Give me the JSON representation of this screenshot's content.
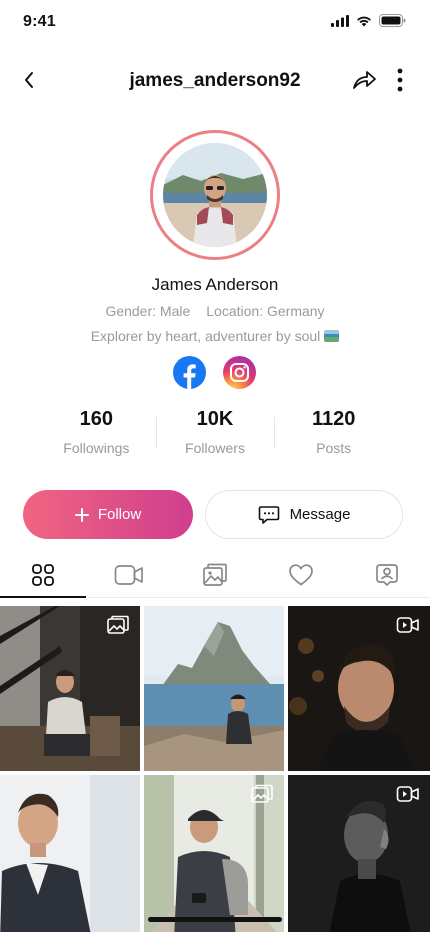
{
  "status_bar": {
    "time": "9:41"
  },
  "header": {
    "username": "james_anderson92"
  },
  "profile": {
    "name": "James Anderson",
    "gender": "Gender: Male",
    "location": "Location: Germany",
    "bio": "Explorer by heart, adventurer by soul"
  },
  "socials": [
    {
      "name": "Facebook",
      "icon": "facebook-icon"
    },
    {
      "name": "Instagram",
      "icon": "instagram-icon"
    }
  ],
  "stats": [
    {
      "value": "160",
      "label": "Followings"
    },
    {
      "value": "10K",
      "label": "Followers"
    },
    {
      "value": "1120",
      "label": "Posts"
    }
  ],
  "actions": {
    "follow_label": "Follow",
    "message_label": "Message"
  },
  "tabs": [
    {
      "icon": "grid-icon",
      "active": true
    },
    {
      "icon": "video-icon",
      "active": false
    },
    {
      "icon": "gallery-icon",
      "active": false
    },
    {
      "icon": "heart-icon",
      "active": false
    },
    {
      "icon": "user-tag-icon",
      "active": false
    }
  ],
  "posts": [
    {
      "type": "photo",
      "subject": "man sitting in cafe"
    },
    {
      "type": "none",
      "subject": "man on coast rock island"
    },
    {
      "type": "video",
      "subject": "man portrait dark"
    },
    {
      "type": "none",
      "subject": "man in suit smiling"
    },
    {
      "type": "photo",
      "subject": "man with backpack and cap"
    },
    {
      "type": "video",
      "subject": "man profile black and white"
    }
  ],
  "colors": {
    "accent_start": "#f06581",
    "accent_end": "#d03e8e",
    "ring": "#ec7e84",
    "muted_text": "#9a9a9a"
  }
}
